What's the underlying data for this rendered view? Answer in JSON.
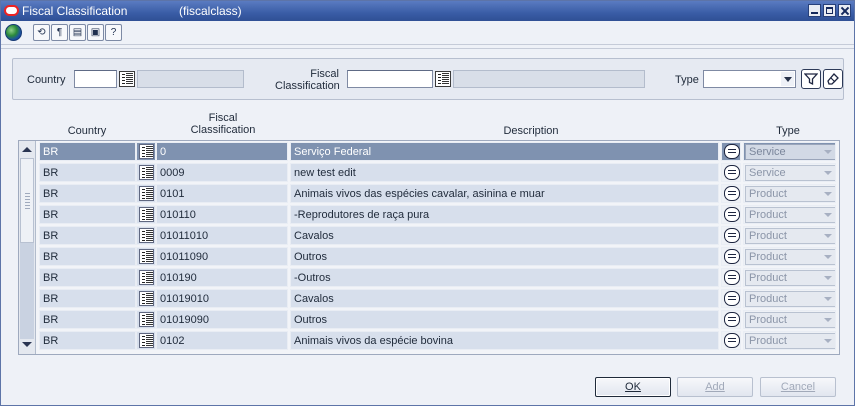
{
  "window": {
    "title": "Fiscal Classification",
    "form_code": "(fiscalclass)"
  },
  "toolbar": {
    "buttons": [
      {
        "icon": "refresh-icon",
        "glyph": "⟲"
      },
      {
        "icon": "find-icon",
        "glyph": "¶"
      },
      {
        "icon": "save-icon",
        "glyph": "▤"
      },
      {
        "icon": "print-icon",
        "glyph": "▣"
      },
      {
        "icon": "help-icon",
        "glyph": "?"
      }
    ]
  },
  "filter": {
    "country_label": "Country",
    "country_value": "",
    "fiscal_label_1": "Fiscal",
    "fiscal_label_2": "Classification",
    "fiscal_value": "",
    "type_label": "Type",
    "type_value": ""
  },
  "grid": {
    "headers": {
      "country": "Country",
      "fiscal_1": "Fiscal",
      "fiscal_2": "Classification",
      "description": "Description",
      "type": "Type"
    },
    "rows": [
      {
        "country": "BR",
        "fiscal": "0",
        "description": "Serviço Federal",
        "type": "Service",
        "selected": true
      },
      {
        "country": "BR",
        "fiscal": "0009",
        "description": "new test edit",
        "type": "Service"
      },
      {
        "country": "BR",
        "fiscal": "0101",
        "description": "Animais vivos das espécies cavalar, asinina e muar",
        "type": "Product"
      },
      {
        "country": "BR",
        "fiscal": "010110",
        "description": "-Reprodutores de raça pura",
        "type": "Product"
      },
      {
        "country": "BR",
        "fiscal": "01011010",
        "description": "Cavalos",
        "type": "Product"
      },
      {
        "country": "BR",
        "fiscal": "01011090",
        "description": "Outros",
        "type": "Product"
      },
      {
        "country": "BR",
        "fiscal": "010190",
        "description": "-Outros",
        "type": "Product"
      },
      {
        "country": "BR",
        "fiscal": "01019010",
        "description": "Cavalos",
        "type": "Product"
      },
      {
        "country": "BR",
        "fiscal": "01019090",
        "description": "Outros",
        "type": "Product"
      },
      {
        "country": "BR",
        "fiscal": "0102",
        "description": "Animais vivos da espécie bovina",
        "type": "Product"
      }
    ]
  },
  "buttons": {
    "ok": "OK",
    "add": "Add",
    "cancel": "Cancel"
  }
}
